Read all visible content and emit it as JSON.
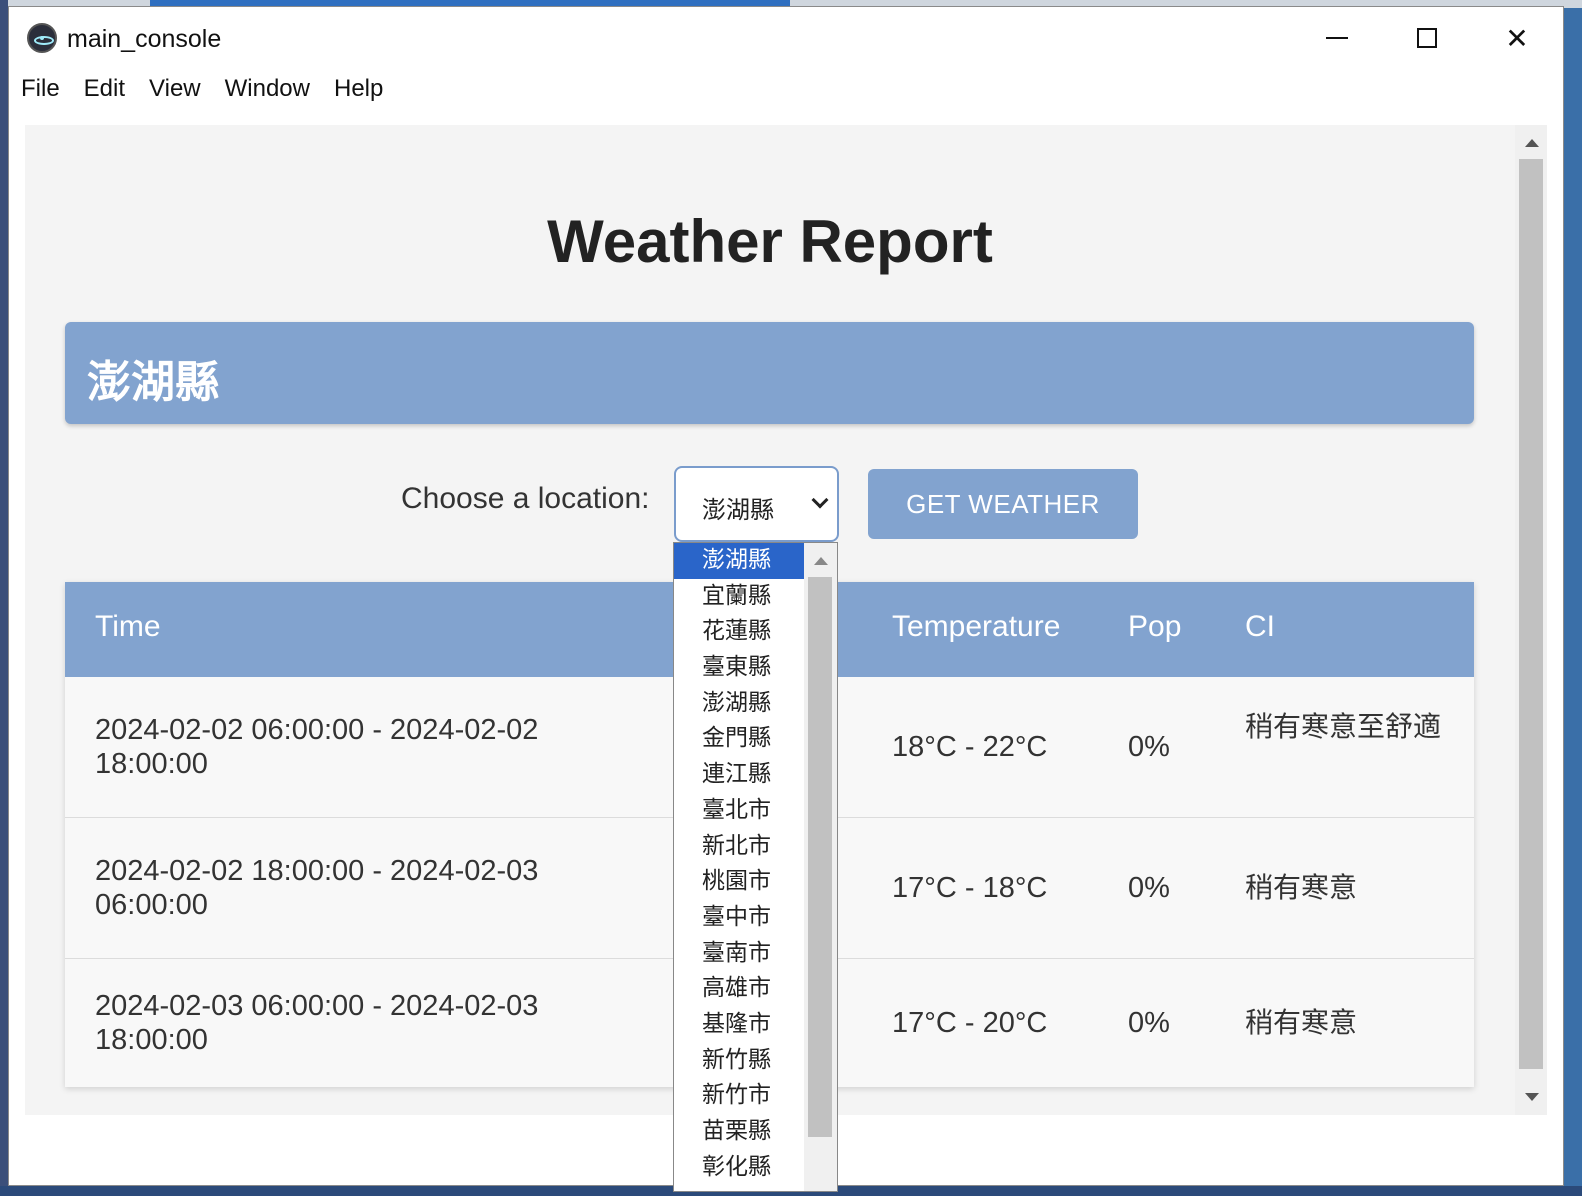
{
  "window": {
    "title": "main_console"
  },
  "menu": [
    "File",
    "Edit",
    "View",
    "Window",
    "Help"
  ],
  "page": {
    "title": "Weather Report",
    "location_banner": "澎湖縣",
    "choose_label": "Choose a location:",
    "selected_location": "澎湖縣",
    "button_label": "GET WEATHER"
  },
  "table": {
    "headers": {
      "time": "Time",
      "temperature": "Temperature",
      "pop": "Pop",
      "ci": "CI"
    },
    "rows": [
      {
        "time": "2024-02-02 06:00:00 - 2024-02-02 18:00:00",
        "temperature": "18°C - 22°C",
        "pop": "0%",
        "ci": "稍有寒意至舒適"
      },
      {
        "time": "2024-02-02 18:00:00 - 2024-02-03 06:00:00",
        "temperature": "17°C - 18°C",
        "pop": "0%",
        "ci": "稍有寒意"
      },
      {
        "time": "2024-02-03 06:00:00 - 2024-02-03 18:00:00",
        "temperature": "17°C - 20°C",
        "pop": "0%",
        "ci": "稍有寒意"
      }
    ]
  },
  "dropdown_options": [
    "澎湖縣",
    "宜蘭縣",
    "花蓮縣",
    "臺東縣",
    "澎湖縣",
    "金門縣",
    "連江縣",
    "臺北市",
    "新北市",
    "桃園市",
    "臺中市",
    "臺南市",
    "高雄市",
    "基隆市",
    "新竹縣",
    "新竹市",
    "苗栗縣",
    "彰化縣"
  ]
}
